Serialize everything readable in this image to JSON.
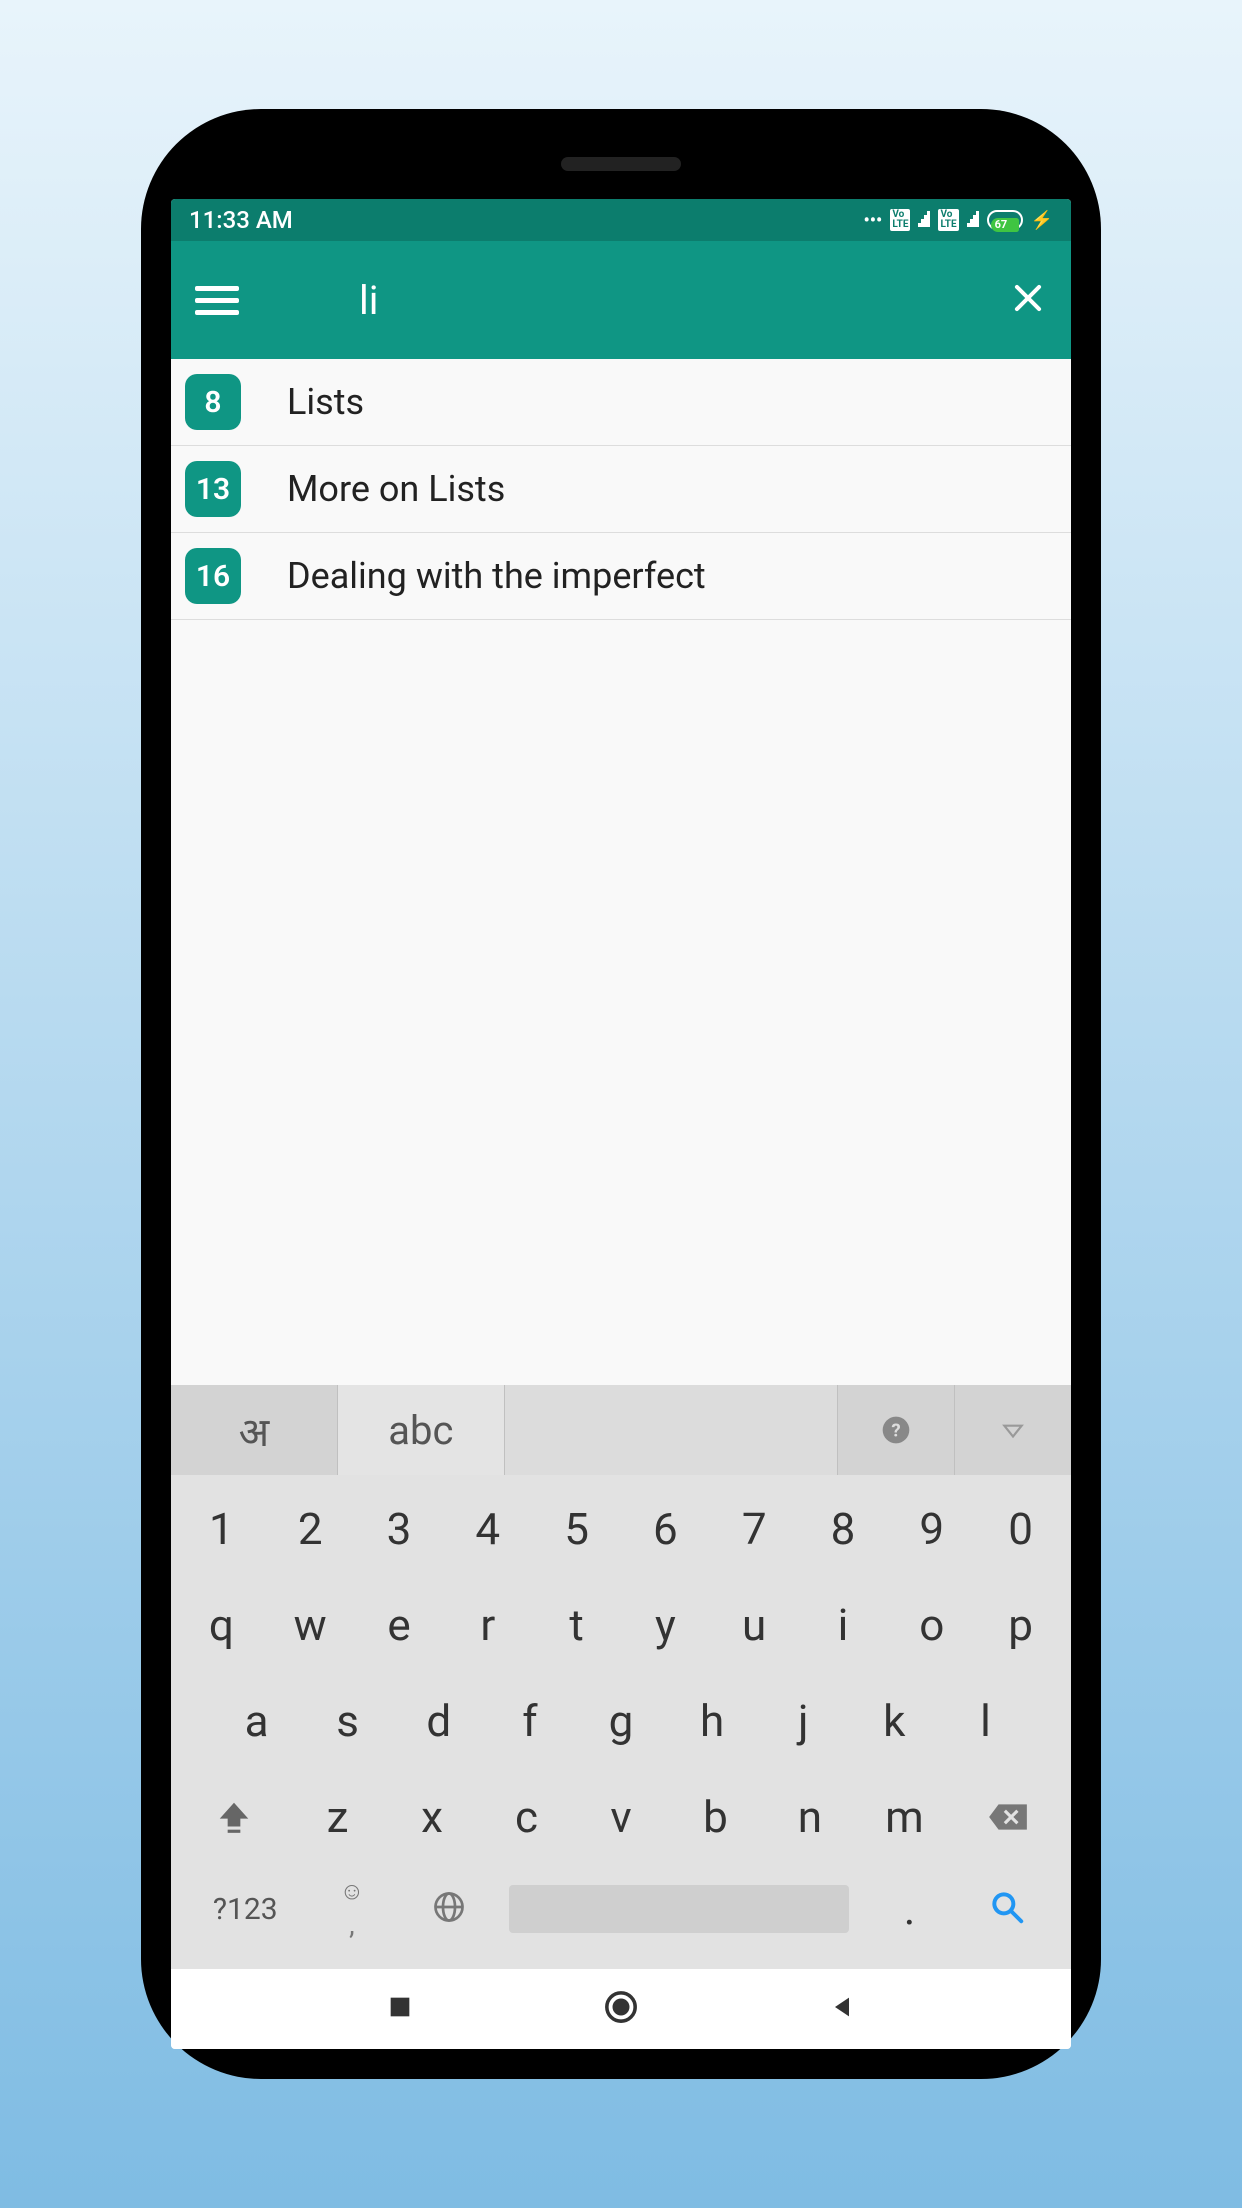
{
  "status": {
    "time": "11:33 AM",
    "battery": "67"
  },
  "appbar": {
    "search_value": "li"
  },
  "results": [
    {
      "num": "8",
      "label": "Lists"
    },
    {
      "num": "13",
      "label": "More on Lists"
    },
    {
      "num": "16",
      "label": "Dealing with the imperfect"
    }
  ],
  "keyboard": {
    "lang1": "अ",
    "lang2": "abc",
    "row1": [
      "1",
      "2",
      "3",
      "4",
      "5",
      "6",
      "7",
      "8",
      "9",
      "0"
    ],
    "row2": [
      "q",
      "w",
      "e",
      "r",
      "t",
      "y",
      "u",
      "i",
      "o",
      "p"
    ],
    "row3": [
      "a",
      "s",
      "d",
      "f",
      "g",
      "h",
      "j",
      "k",
      "l"
    ],
    "row4": [
      "z",
      "x",
      "c",
      "v",
      "b",
      "n",
      "m"
    ],
    "sym_key": "?123",
    "comma": ",",
    "dot": "."
  }
}
